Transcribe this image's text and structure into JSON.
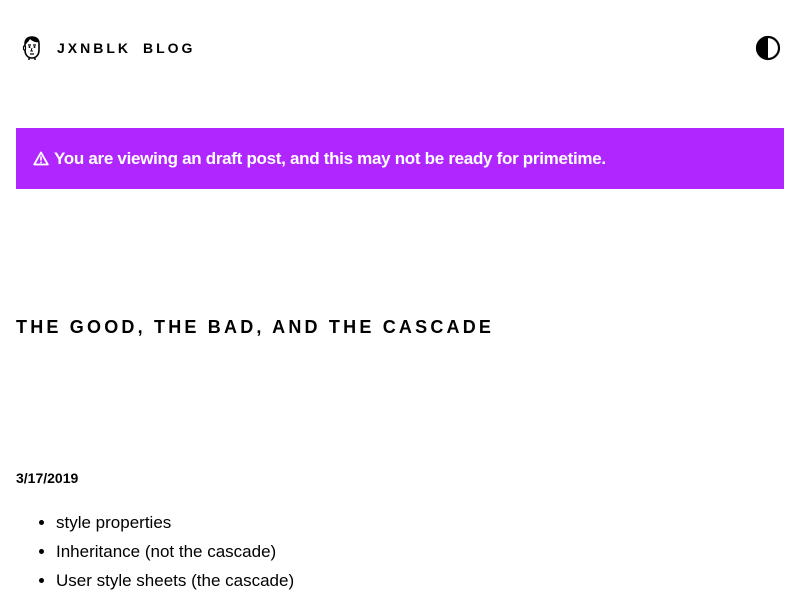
{
  "header": {
    "logo_icon": "avatar-face-icon",
    "nav_home": "JXNBLK",
    "nav_blog": "BLOG",
    "theme_toggle_icon": "contrast-half-circle-icon"
  },
  "banner": {
    "icon": "warning-triangle-icon",
    "text": "You are viewing an draft post, and this may not be ready for primetime.",
    "background_color": "#b026ff",
    "text_color": "#ffffff"
  },
  "post": {
    "title": "THE GOOD, THE BAD, AND THE CASCADE",
    "date": "3/17/2019",
    "list": [
      "style properties",
      "Inheritance (not the cascade)",
      "User style sheets (the cascade)"
    ]
  }
}
